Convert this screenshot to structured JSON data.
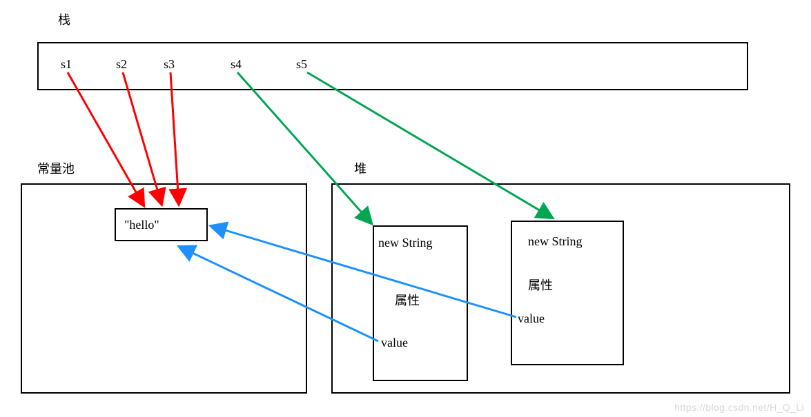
{
  "labels": {
    "stack_title": "栈",
    "const_pool_title": "常量池",
    "heap_title": "堆"
  },
  "stack": {
    "vars": [
      "s1",
      "s2",
      "s3",
      "s4",
      "s5"
    ]
  },
  "const_pool": {
    "literal": "\"hello\""
  },
  "heap": {
    "obj1": {
      "header": "new String",
      "attr_label": "属性",
      "value_label": "value"
    },
    "obj2": {
      "header": "new String",
      "attr_label": "属性",
      "value_label": "value"
    }
  },
  "arrows": {
    "red_targets_hello": [
      "s1",
      "s2",
      "s3"
    ],
    "green_targets_heap": {
      "s4": "obj1",
      "s5": "obj2"
    },
    "blue_value_to_hello": [
      "obj1",
      "obj2"
    ]
  },
  "colors": {
    "red": "#ff0000",
    "green": "#00a651",
    "blue": "#1e90ff",
    "border": "#000000"
  },
  "watermark": "https://blog.csdn.net/H_Q_Li"
}
